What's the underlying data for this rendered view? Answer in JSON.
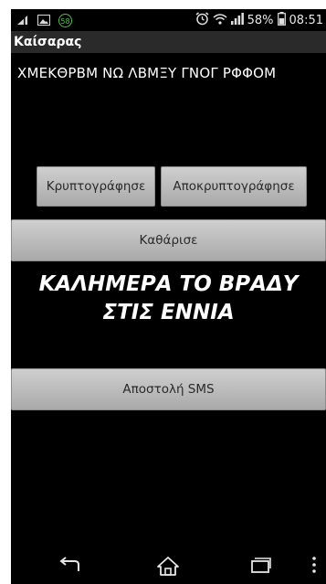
{
  "status_bar": {
    "notification_badge": "58",
    "battery_percent": "58%",
    "time": "08:51",
    "icons": [
      "signal-strength-icon",
      "image-icon",
      "badge-58-icon",
      "alarm-clock-icon",
      "wifi-icon",
      "cell-signal-icon",
      "battery-icon"
    ]
  },
  "app": {
    "title": "Καίσαρας"
  },
  "input": {
    "value": "ΧΜΕΚΘΡΒΜ ΝΩ ΛΒΜΞΥ ΓΝΟΓ ΡΦΦΟΜ"
  },
  "buttons": {
    "encrypt": "Κρυπτογράφησε",
    "decrypt": "Αποκρυπτογράφησε",
    "clear": "Καθάρισε",
    "sms": "Αποστολή SMS"
  },
  "result": {
    "text": "ΚΑΛΗΜΕΡΑ ΤΟ ΒΡΑΔΥ ΣΤΙΣ ΕΝΝΙΑ"
  },
  "navbar": {
    "icons": [
      "back-icon",
      "home-icon",
      "recent-apps-icon",
      "overflow-menu-icon"
    ]
  }
}
